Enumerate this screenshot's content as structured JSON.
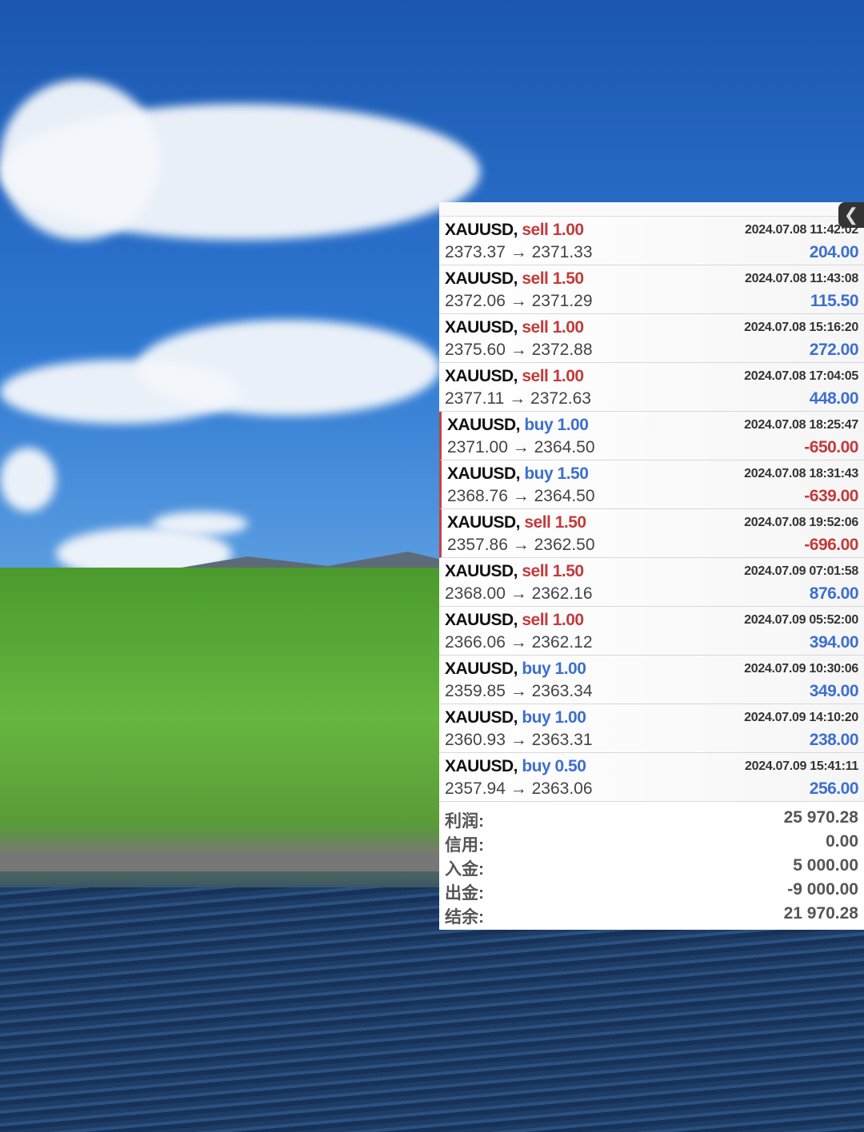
{
  "trades": [
    {
      "symbol": "XAUUSD,",
      "type": "sell",
      "volume": "1.00",
      "time": "2024.07.08 11:42:02",
      "open": "2373.37",
      "close": "2371.33",
      "profit": "204.00"
    },
    {
      "symbol": "XAUUSD,",
      "type": "sell",
      "volume": "1.50",
      "time": "2024.07.08 11:43:08",
      "open": "2372.06",
      "close": "2371.29",
      "profit": "115.50"
    },
    {
      "symbol": "XAUUSD,",
      "type": "sell",
      "volume": "1.00",
      "time": "2024.07.08 15:16:20",
      "open": "2375.60",
      "close": "2372.88",
      "profit": "272.00"
    },
    {
      "symbol": "XAUUSD,",
      "type": "sell",
      "volume": "1.00",
      "time": "2024.07.08 17:04:05",
      "open": "2377.11",
      "close": "2372.63",
      "profit": "448.00"
    },
    {
      "symbol": "XAUUSD,",
      "type": "buy",
      "volume": "1.00",
      "time": "2024.07.08 18:25:47",
      "open": "2371.00",
      "close": "2364.50",
      "profit": "-650.00"
    },
    {
      "symbol": "XAUUSD,",
      "type": "buy",
      "volume": "1.50",
      "time": "2024.07.08 18:31:43",
      "open": "2368.76",
      "close": "2364.50",
      "profit": "-639.00"
    },
    {
      "symbol": "XAUUSD,",
      "type": "sell",
      "volume": "1.50",
      "time": "2024.07.08 19:52:06",
      "open": "2357.86",
      "close": "2362.50",
      "profit": "-696.00"
    },
    {
      "symbol": "XAUUSD,",
      "type": "sell",
      "volume": "1.50",
      "time": "2024.07.09 07:01:58",
      "open": "2368.00",
      "close": "2362.16",
      "profit": "876.00"
    },
    {
      "symbol": "XAUUSD,",
      "type": "sell",
      "volume": "1.00",
      "time": "2024.07.09 05:52:00",
      "open": "2366.06",
      "close": "2362.12",
      "profit": "394.00"
    },
    {
      "symbol": "XAUUSD,",
      "type": "buy",
      "volume": "1.00",
      "time": "2024.07.09 10:30:06",
      "open": "2359.85",
      "close": "2363.34",
      "profit": "349.00"
    },
    {
      "symbol": "XAUUSD,",
      "type": "buy",
      "volume": "1.00",
      "time": "2024.07.09 14:10:20",
      "open": "2360.93",
      "close": "2363.31",
      "profit": "238.00"
    },
    {
      "symbol": "XAUUSD,",
      "type": "buy",
      "volume": "0.50",
      "time": "2024.07.09 15:41:11",
      "open": "2357.94",
      "close": "2363.06",
      "profit": "256.00"
    }
  ],
  "arrow": "→",
  "summary": [
    {
      "label": "利润:",
      "value": "25 970.28"
    },
    {
      "label": "信用:",
      "value": "0.00"
    },
    {
      "label": "入金:",
      "value": "5 000.00"
    },
    {
      "label": "出金:",
      "value": "-9 000.00"
    },
    {
      "label": "结余:",
      "value": "21 970.28"
    }
  ],
  "toggle_icon": "chevron-left-icon",
  "colors": {
    "sell": "#c23b3b",
    "buy": "#3d6fd0",
    "loss": "#c23b3b",
    "profit": "#3d6fd0"
  }
}
